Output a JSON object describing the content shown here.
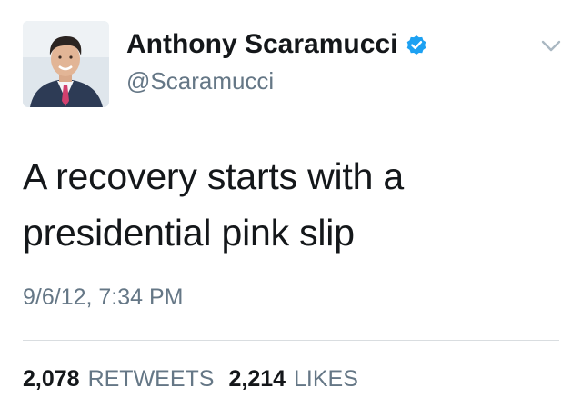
{
  "tweet": {
    "author": {
      "display_name": "Anthony Scaramucci",
      "handle": "@Scaramucci",
      "verified": true,
      "avatar_icon": "avatar-photo"
    },
    "text_lines": [
      "A recovery starts with a",
      "presidential pink slip"
    ],
    "timestamp": "9/6/12, 7:34 PM",
    "stats": {
      "retweets_count": "2,078",
      "retweets_label": "RETWEETS",
      "likes_count": "2,214",
      "likes_label": "LIKES"
    },
    "icons": {
      "verified": "verified-badge-icon",
      "menu": "chevron-down-icon"
    }
  },
  "colors": {
    "text_primary": "#14171a",
    "text_secondary": "#657786",
    "verified_blue": "#1da1f2",
    "divider": "#d9dde0",
    "chevron": "#aab8c2"
  }
}
